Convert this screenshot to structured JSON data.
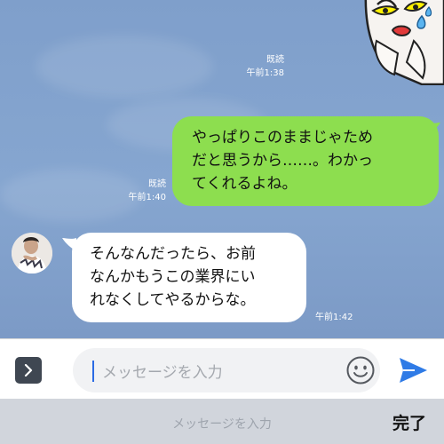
{
  "colors": {
    "chat_background": "#86a6d0",
    "outgoing_bubble": "#8dde4f",
    "incoming_bubble": "#ffffff",
    "send_accent": "#2f7be6"
  },
  "messages": [
    {
      "direction": "out",
      "type": "sticker",
      "icon": "sticker-character-icon",
      "read_label": "既読",
      "time": "午前1:38"
    },
    {
      "direction": "out",
      "type": "text",
      "lines": [
        "やっぱりこのままじゃため",
        "だと思うから……。わかっ",
        "てくれるよね。"
      ],
      "read_label": "既読",
      "time": "午前1:40"
    },
    {
      "direction": "in",
      "type": "text",
      "avatar_icon": "avatar-icon",
      "lines": [
        "そんなんだったら、お前",
        "なんかもうこの業界にい",
        "れなくしてやるからな。"
      ],
      "time": "午前1:42"
    }
  ],
  "input_bar": {
    "expand_icon": "chevron-right-icon",
    "placeholder": "メッセージを入力",
    "emoji_icon": "smiley-icon",
    "send_icon": "send-icon"
  },
  "keyboard_bar": {
    "placeholder": "メッセージを入力",
    "done_label": "完了"
  }
}
